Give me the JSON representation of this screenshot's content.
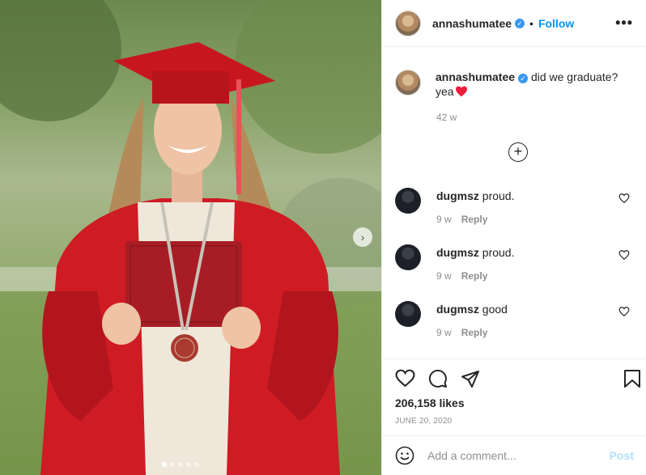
{
  "post": {
    "username": "annashumatee",
    "verified": true,
    "follow_label": "Follow",
    "more_label": "•••",
    "separator": "•",
    "caption": "did we graduate? yea",
    "caption_emoji": "heart",
    "caption_time": "42 w",
    "load_more_label": "+",
    "likes": "206,158 likes",
    "date": "JUNE 20, 2020"
  },
  "comments": [
    {
      "username": "dugmsz",
      "text": "proud.",
      "time": "9 w",
      "reply_label": "Reply"
    },
    {
      "username": "dugmsz",
      "text": "proud.",
      "time": "9 w",
      "reply_label": "Reply"
    },
    {
      "username": "dugmsz",
      "text": "good",
      "time": "9 w",
      "reply_label": "Reply"
    }
  ],
  "add_comment": {
    "placeholder": "Add a comment...",
    "post_label": "Post",
    "emoji_icon": "smiley-icon"
  },
  "icons": {
    "like": "heart-icon",
    "comment": "comment-icon",
    "share": "share-icon",
    "save": "bookmark-icon",
    "next": "chevron-right-icon"
  },
  "colors": {
    "accent": "#0095f6",
    "heart": "#ed4956",
    "muted": "#8e8e8e",
    "verified": "#3897f0"
  }
}
